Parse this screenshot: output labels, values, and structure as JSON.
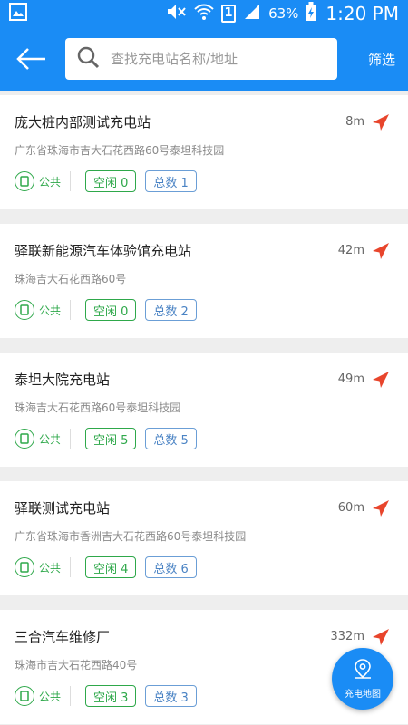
{
  "status": {
    "battery_pct": "63%",
    "time": "1:20 PM",
    "sim_label": "1"
  },
  "header": {
    "search_placeholder": "查找充电站名称/地址",
    "filter_label": "筛选"
  },
  "stations": [
    {
      "name": "庞大桩内部测试充电站",
      "distance": "8m",
      "address": "广东省珠海市吉大石花西路60号泰坦科技园",
      "type": "公共",
      "free": "空闲 0",
      "total": "总数 1"
    },
    {
      "name": "驿联新能源汽车体验馆充电站",
      "distance": "42m",
      "address": "珠海吉大石花西路60号",
      "type": "公共",
      "free": "空闲 0",
      "total": "总数 2"
    },
    {
      "name": "泰坦大院充电站",
      "distance": "49m",
      "address": "珠海吉大石花西路60号泰坦科技园",
      "type": "公共",
      "free": "空闲 5",
      "total": "总数 5"
    },
    {
      "name": "驿联测试充电站",
      "distance": "60m",
      "address": "广东省珠海市香洲吉大石花西路60号泰坦科技园",
      "type": "公共",
      "free": "空闲 4",
      "total": "总数 6"
    },
    {
      "name": "三合汽车维修厂",
      "distance": "332m",
      "address": "珠海市吉大石花西路40号",
      "type": "公共",
      "free": "空闲 3",
      "total": "总数 3"
    }
  ],
  "fab": {
    "label": "充电地图"
  },
  "colors": {
    "primary": "#1a8cf5",
    "green": "#2ea84a",
    "nav_red": "#e8452c"
  }
}
